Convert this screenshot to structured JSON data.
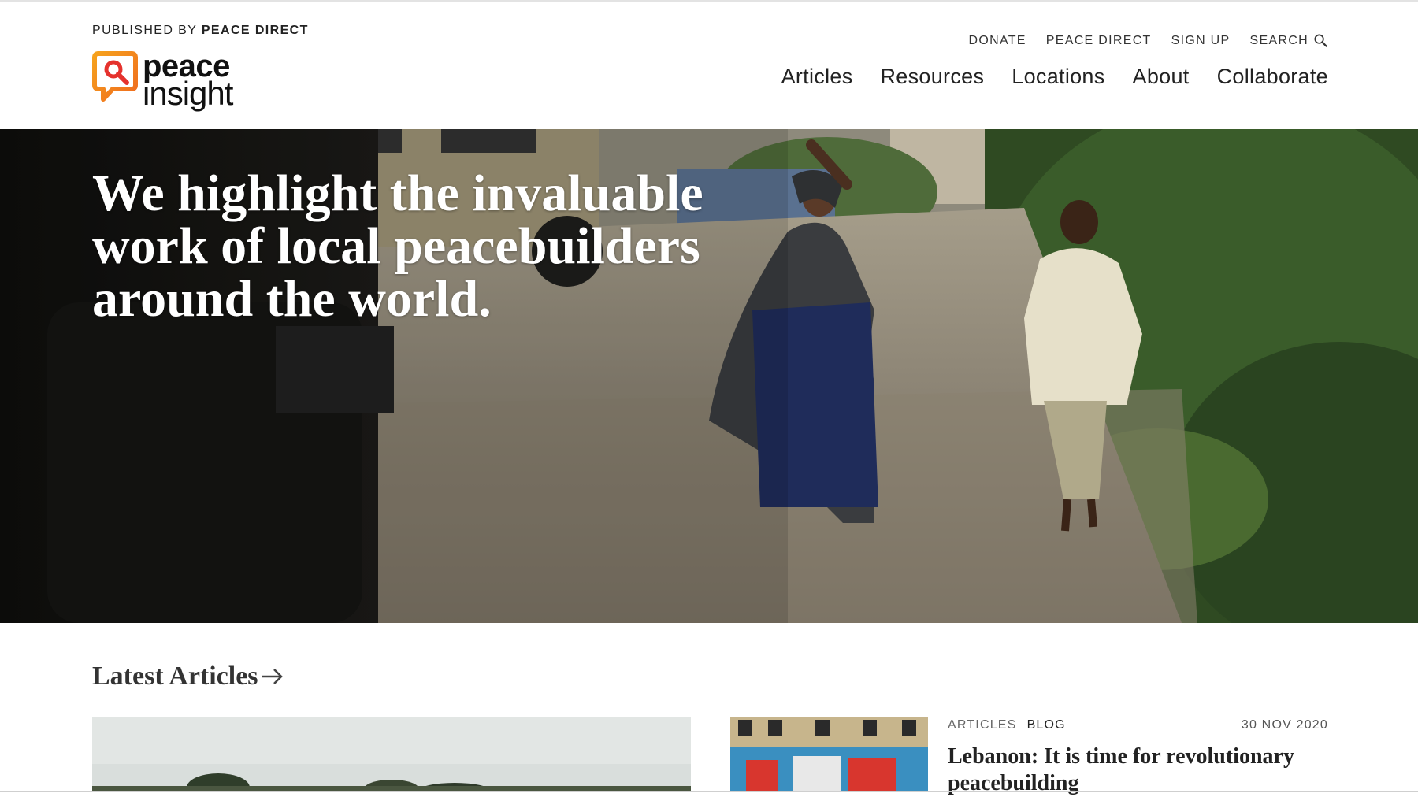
{
  "header": {
    "published_prefix": "PUBLISHED BY",
    "published_org": "PEACE DIRECT",
    "logo": {
      "word1": "peace",
      "word2": "insight"
    },
    "utility_nav": [
      {
        "label": "DONATE"
      },
      {
        "label": "PEACE DIRECT"
      },
      {
        "label": "SIGN UP"
      },
      {
        "label": "SEARCH",
        "icon": "search-icon"
      }
    ],
    "main_nav": [
      {
        "label": "Articles"
      },
      {
        "label": "Resources"
      },
      {
        "label": "Locations"
      },
      {
        "label": "About"
      },
      {
        "label": "Collaborate"
      }
    ]
  },
  "hero": {
    "title": "We highlight the invaluable work of local peacebuilders around the world."
  },
  "latest": {
    "title": "Latest Articles",
    "icon": "arrow-right-icon",
    "card": {
      "category1": "ARTICLES",
      "category2": "BLOG",
      "date": "30 NOV 2020",
      "title": "Lebanon: It is time for revolutionary peacebuilding"
    }
  },
  "colors": {
    "logo_orange": "#f08a1c",
    "logo_red": "#e5322d",
    "text_dark": "#222222"
  }
}
